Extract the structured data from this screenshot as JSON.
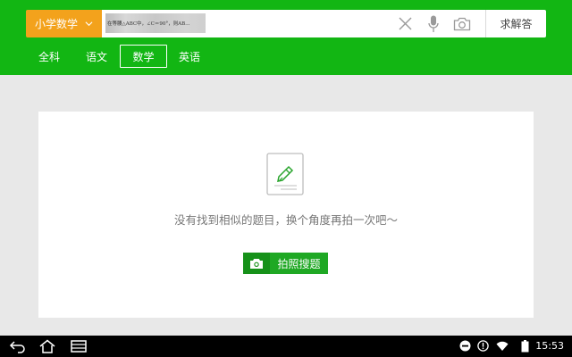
{
  "header": {
    "grade_label": "小学数学",
    "query_image_text": "在等腰△ABC中，∠C＝90°，则AB…",
    "solve_label": "求解答"
  },
  "tabs": [
    {
      "label": "全科",
      "active": false
    },
    {
      "label": "语文",
      "active": false
    },
    {
      "label": "数学",
      "active": true
    },
    {
      "label": "英语",
      "active": false
    }
  ],
  "result": {
    "empty_message": "没有找到相似的题目，换个角度再拍一次吧～",
    "photo_search_label": "拍照搜题"
  },
  "status_bar": {
    "time": "15:53"
  },
  "colors": {
    "brand_green": "#12b613",
    "grade_orange": "#f3a21c",
    "button_green": "#1fa824"
  },
  "icons": [
    "chevron-down-icon",
    "clear-icon",
    "microphone-icon",
    "camera-icon",
    "pen-note-icon",
    "back-icon",
    "home-icon",
    "recent-apps-icon",
    "dnd-icon",
    "alert-icon",
    "wifi-icon",
    "battery-icon"
  ]
}
